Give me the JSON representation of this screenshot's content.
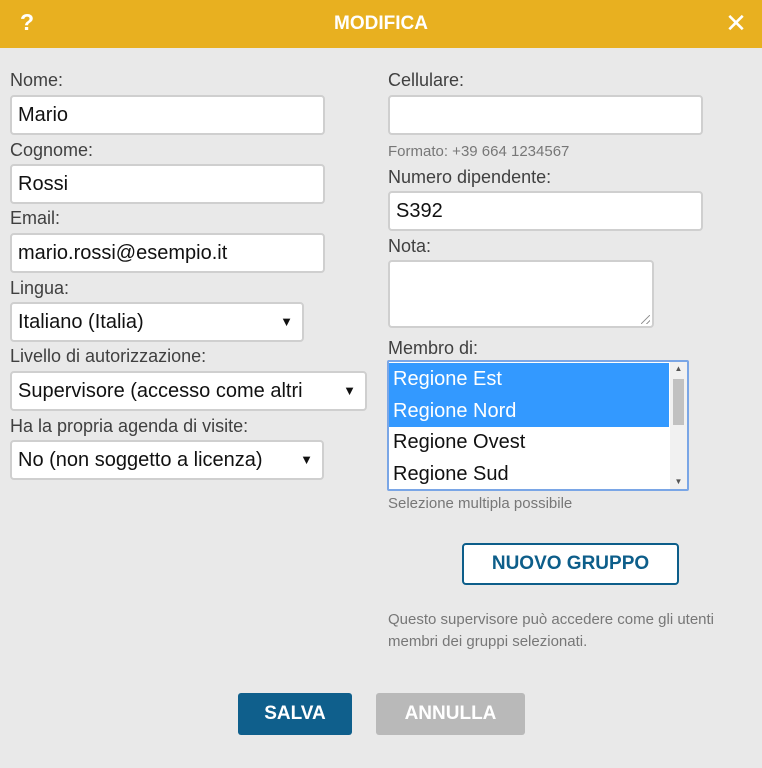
{
  "header": {
    "help_label": "?",
    "title": "MODIFICA",
    "close_label": "✕",
    "background_color": "#e8b020"
  },
  "left": {
    "first_name": {
      "label": "Nome:",
      "value": "Mario"
    },
    "last_name": {
      "label": "Cognome:",
      "value": "Rossi"
    },
    "email": {
      "label": "Email:",
      "value": "mario.rossi@esempio.it"
    },
    "language": {
      "label": "Lingua:",
      "value": "Italiano (Italia)"
    },
    "authorization": {
      "label": "Livello di autorizzazione:",
      "value": "Supervisore (accesso come altri"
    },
    "own_agenda": {
      "label": "Ha la propria agenda di visite:",
      "value": "No (non soggetto a licenza)"
    }
  },
  "right": {
    "mobile": {
      "label": "Cellulare:",
      "value": "",
      "hint": "Formato: +39 664 1234567"
    },
    "employee_number": {
      "label": "Numero dipendente:",
      "value": "S392"
    },
    "note": {
      "label": "Nota:",
      "value": ""
    },
    "member_of": {
      "label": "Membro di:",
      "options": [
        {
          "label": "Regione Est",
          "selected": true
        },
        {
          "label": "Regione Nord",
          "selected": true
        },
        {
          "label": "Regione Ovest",
          "selected": false
        },
        {
          "label": "Regione Sud",
          "selected": false
        }
      ],
      "hint": "Selezione multipla possibile"
    },
    "new_group_label": "NUOVO GRUPPO",
    "info_line1": "Questo supervisore può accedere come gli utenti",
    "info_line2": "membri dei gruppi selezionati."
  },
  "footer": {
    "save_label": "SALVA",
    "cancel_label": "ANNULLA",
    "save_color": "#0f5f8c",
    "cancel_color": "#b9b9b9"
  },
  "icons": {
    "dropdown": "triangle-down-icon",
    "scroll_up": "scroll-up-icon",
    "scroll_down": "scroll-down-icon"
  }
}
